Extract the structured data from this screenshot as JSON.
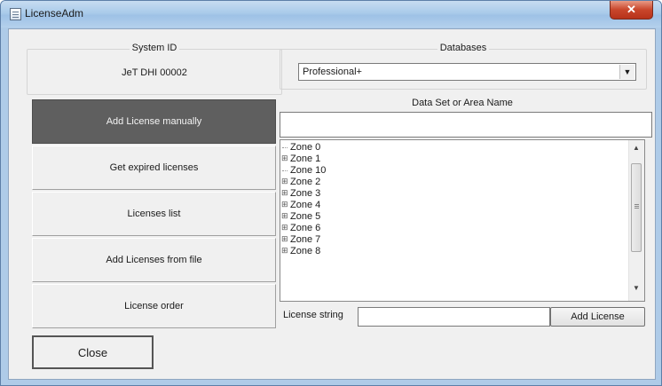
{
  "window": {
    "title": "LicenseAdm",
    "close_glyph": "✕",
    "app_icon": "app-window-icon"
  },
  "system_id": {
    "legend": "System ID",
    "value": "JeT DHI 00002"
  },
  "databases": {
    "legend": "Databases",
    "selected": "Professional+",
    "dropdown_arrow": "▼"
  },
  "dataset": {
    "label": "Data Set or Area Name",
    "value": ""
  },
  "left_menu": [
    {
      "label": "Add License manually",
      "active": true
    },
    {
      "label": "Get expired licenses",
      "active": false
    },
    {
      "label": "Licenses list",
      "active": false
    },
    {
      "label": "Add Licenses from file",
      "active": false
    },
    {
      "label": "License order",
      "active": false
    }
  ],
  "zones": [
    {
      "label": "Zone 0",
      "expandable": false
    },
    {
      "label": "Zone 1",
      "expandable": true
    },
    {
      "label": "Zone 10",
      "expandable": false
    },
    {
      "label": "Zone 2",
      "expandable": true
    },
    {
      "label": "Zone 3",
      "expandable": true
    },
    {
      "label": "Zone 4",
      "expandable": true
    },
    {
      "label": "Zone 5",
      "expandable": true
    },
    {
      "label": "Zone 6",
      "expandable": true
    },
    {
      "label": "Zone 7",
      "expandable": true
    },
    {
      "label": "Zone 8",
      "expandable": true
    }
  ],
  "tree_glyphs": {
    "expand": "⊞",
    "scroll_up": "▲",
    "scroll_down": "▼"
  },
  "license": {
    "label": "License string",
    "value": "",
    "add_button": "Add License"
  },
  "close_button": "Close"
}
